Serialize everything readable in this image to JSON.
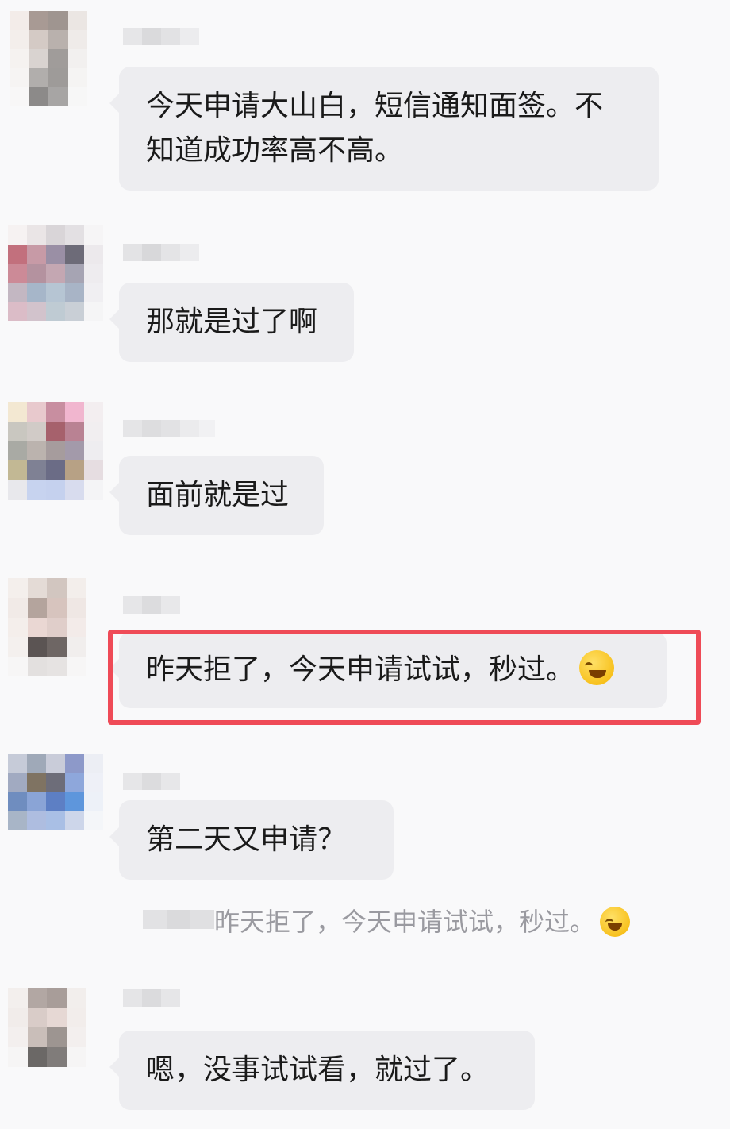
{
  "messages": [
    {
      "text": "今天申请大山白，短信通知面签。不",
      "text2": "知道成功率高不高。"
    },
    {
      "text": "那就是过了啊"
    },
    {
      "text": "面前就是过"
    },
    {
      "text": "昨天拒了，今天申请试试，秒过。",
      "emoji": "face-with-tears-of-joy"
    },
    {
      "text": "第二天又申请？",
      "quote": "昨天拒了，今天申请试试，秒过。",
      "quote_emoji": "face-with-tears-of-joy"
    },
    {
      "text": "嗯，没事试试看，就过了。"
    }
  ],
  "highlight_color": "#ef4b57"
}
